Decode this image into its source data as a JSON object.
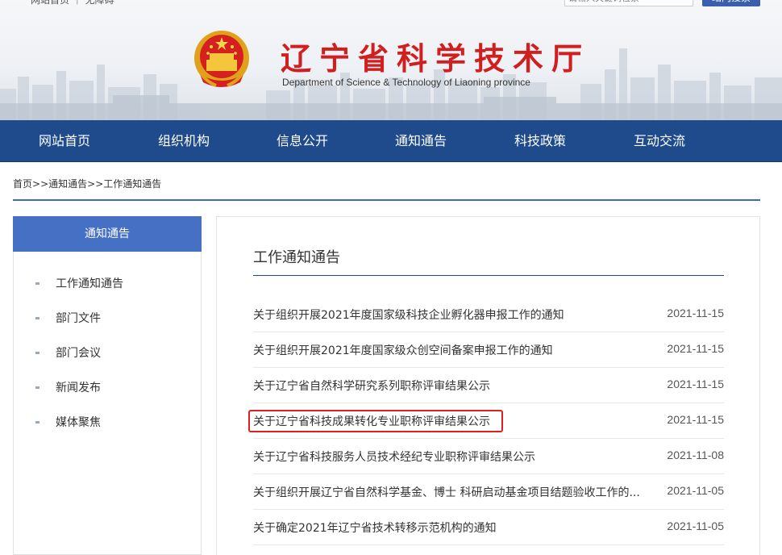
{
  "header": {
    "topbar_text": "网站首页 ｜ 无障碍",
    "search_placeholder": "请输入关键词检索",
    "search_button": "站内搜索",
    "title": "辽宁省科学技术厅",
    "subtitle": "Department of Science & Technology of Liaoning province",
    "emblem_icon": "national-emblem-icon"
  },
  "nav": {
    "items": [
      {
        "label": "网站首页"
      },
      {
        "label": "组织机构"
      },
      {
        "label": "信息公开"
      },
      {
        "label": "通知通告"
      },
      {
        "label": "科技政策"
      },
      {
        "label": "互动交流"
      }
    ]
  },
  "breadcrumb": {
    "home": "首页",
    "sep": ">>",
    "section": "通知通告",
    "current": "工作通知通告"
  },
  "sidebar": {
    "heading": "通知通告",
    "items": [
      {
        "label": "工作通知通告"
      },
      {
        "label": "部门文件"
      },
      {
        "label": "部门会议"
      },
      {
        "label": "新闻发布"
      },
      {
        "label": "媒体聚焦"
      }
    ]
  },
  "main": {
    "title": "工作通知通告",
    "rows": [
      {
        "title": "关于组织开展2021年度国家级科技企业孵化器申报工作的通知",
        "date": "2021-11-15"
      },
      {
        "title": "关于组织开展2021年度国家级众创空间备案申报工作的通知",
        "date": "2021-11-15"
      },
      {
        "title": "关于辽宁省自然科学研究系列职称评审结果公示",
        "date": "2021-11-15"
      },
      {
        "title": "关于辽宁省科技成果转化专业职称评审结果公示",
        "date": "2021-11-15"
      },
      {
        "title": "关于辽宁省科技服务人员技术经纪专业职称评审结果公示",
        "date": "2021-11-08"
      },
      {
        "title": "关于组织开展辽宁省自然科学基金、博士 科研启动基金项目结题验收工作的...",
        "date": "2021-11-05"
      },
      {
        "title": "关于确定2021年辽宁省技术转移示范机构的通知",
        "date": "2021-11-05"
      }
    ]
  },
  "colors": {
    "nav_bg": "#1f4b8c",
    "sidebar_head_bg": "#4670c4",
    "title_red": "#d11f1f",
    "highlight": "#e02020"
  }
}
